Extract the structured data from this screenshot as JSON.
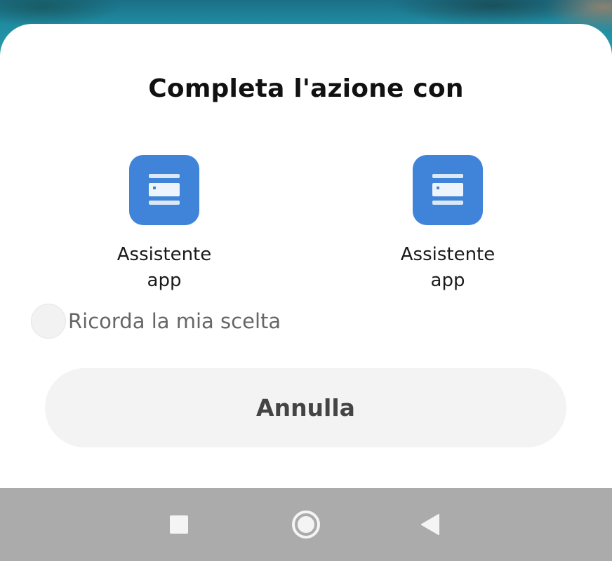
{
  "dialog": {
    "title": "Completa l'azione con",
    "apps": [
      {
        "label": "Assistente\napp",
        "icon": "app-card-icon",
        "icon_color": "#3f84d8"
      },
      {
        "label": "Assistente\napp",
        "icon": "app-card-icon",
        "icon_color": "#3f84d8"
      }
    ],
    "remember_label": "Ricorda la mia scelta",
    "remember_checked": false,
    "cancel_label": "Annulla"
  },
  "navbar": {
    "background": "#ababab",
    "buttons": [
      "recents-icon",
      "home-icon",
      "back-icon"
    ]
  }
}
